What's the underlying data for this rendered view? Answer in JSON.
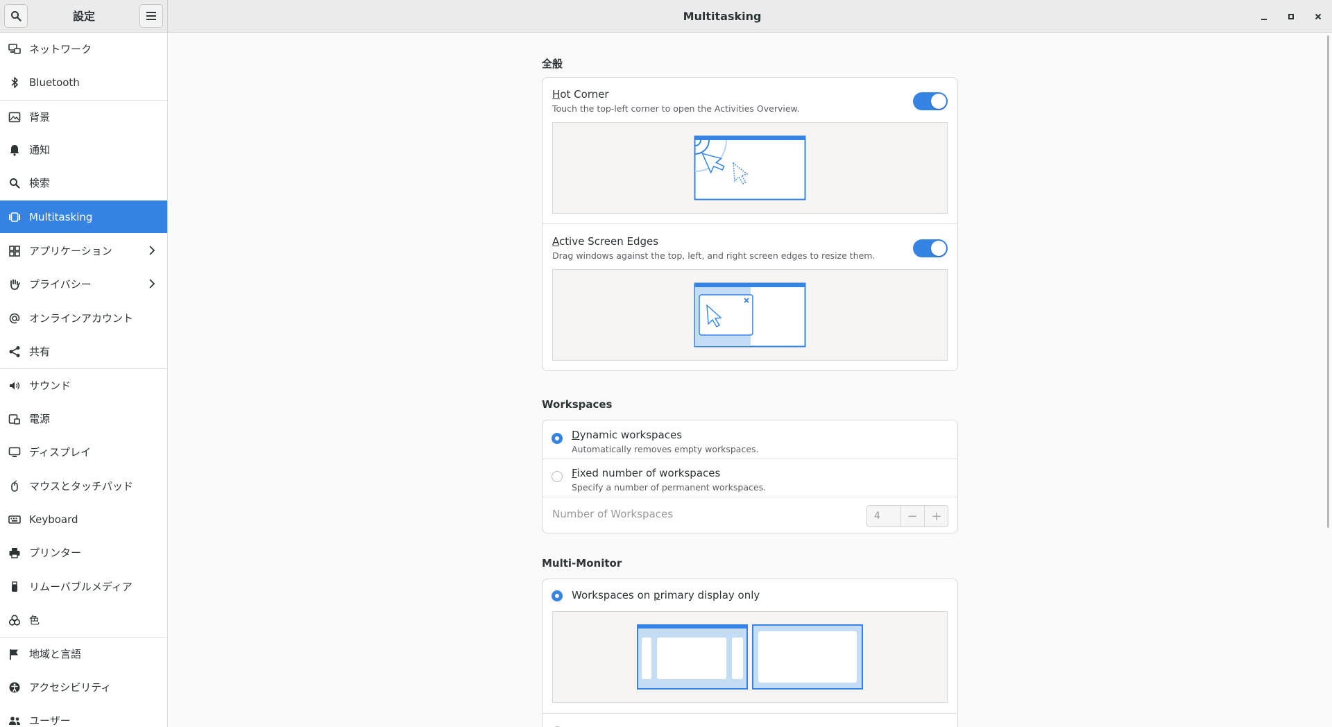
{
  "window": {
    "app_title": "設定",
    "page_title": "Multitasking"
  },
  "sidebar": {
    "items": [
      {
        "label": "ネットワーク",
        "icon": "network-icon"
      },
      {
        "label": "Bluetooth",
        "icon": "bluetooth-icon"
      },
      {
        "label": "背景",
        "icon": "background-icon"
      },
      {
        "label": "通知",
        "icon": "bell-icon"
      },
      {
        "label": "検索",
        "icon": "search-icon"
      },
      {
        "label": "Multitasking",
        "icon": "multitasking-icon"
      },
      {
        "label": "アプリケーション",
        "icon": "apps-grid-icon"
      },
      {
        "label": "プライバシー",
        "icon": "hand-icon"
      },
      {
        "label": "オンラインアカウント",
        "icon": "at-icon"
      },
      {
        "label": "共有",
        "icon": "share-icon"
      },
      {
        "label": "サウンド",
        "icon": "speaker-icon"
      },
      {
        "label": "電源",
        "icon": "battery-icon"
      },
      {
        "label": "ディスプレイ",
        "icon": "display-icon"
      },
      {
        "label": "マウスとタッチパッド",
        "icon": "mouse-icon"
      },
      {
        "label": "Keyboard",
        "icon": "keyboard-icon"
      },
      {
        "label": "プリンター",
        "icon": "printer-icon"
      },
      {
        "label": "リムーバブルメディア",
        "icon": "usb-icon"
      },
      {
        "label": "色",
        "icon": "color-icon"
      },
      {
        "label": "地域と言語",
        "icon": "flag-icon"
      },
      {
        "label": "アクセシビリティ",
        "icon": "accessibility-icon"
      },
      {
        "label": "ユーザー",
        "icon": "users-icon"
      }
    ],
    "active": "Multitasking"
  },
  "general": {
    "section_title": "全般",
    "hot_corner": {
      "mnemonic": "H",
      "title_rest": "ot Corner",
      "subtitle": "Touch the top-left corner to open the Activities Overview.",
      "enabled": true
    },
    "active_edges": {
      "mnemonic": "A",
      "title_rest": "ctive Screen Edges",
      "subtitle": "Drag windows against the top, left, and right screen edges to resize them.",
      "enabled": true
    }
  },
  "workspaces": {
    "section_title": "Workspaces",
    "dynamic": {
      "mnemonic": "D",
      "title_rest": "ynamic workspaces",
      "subtitle": "Automatically removes empty workspaces.",
      "selected": true
    },
    "fixed": {
      "mnemonic": "F",
      "title_rest": "ixed number of workspaces",
      "subtitle": "Specify a number of permanent workspaces.",
      "selected": false
    },
    "number_label": "Number of Workspaces",
    "number_value": "4",
    "minus": "−",
    "plus": "+"
  },
  "multi_monitor": {
    "section_title": "Multi-Monitor",
    "primary_only": {
      "before": "Workspaces on ",
      "mnemonic": "p",
      "after": "rimary display only",
      "selected": true
    }
  },
  "colors": {
    "accent": "#3584e4"
  }
}
